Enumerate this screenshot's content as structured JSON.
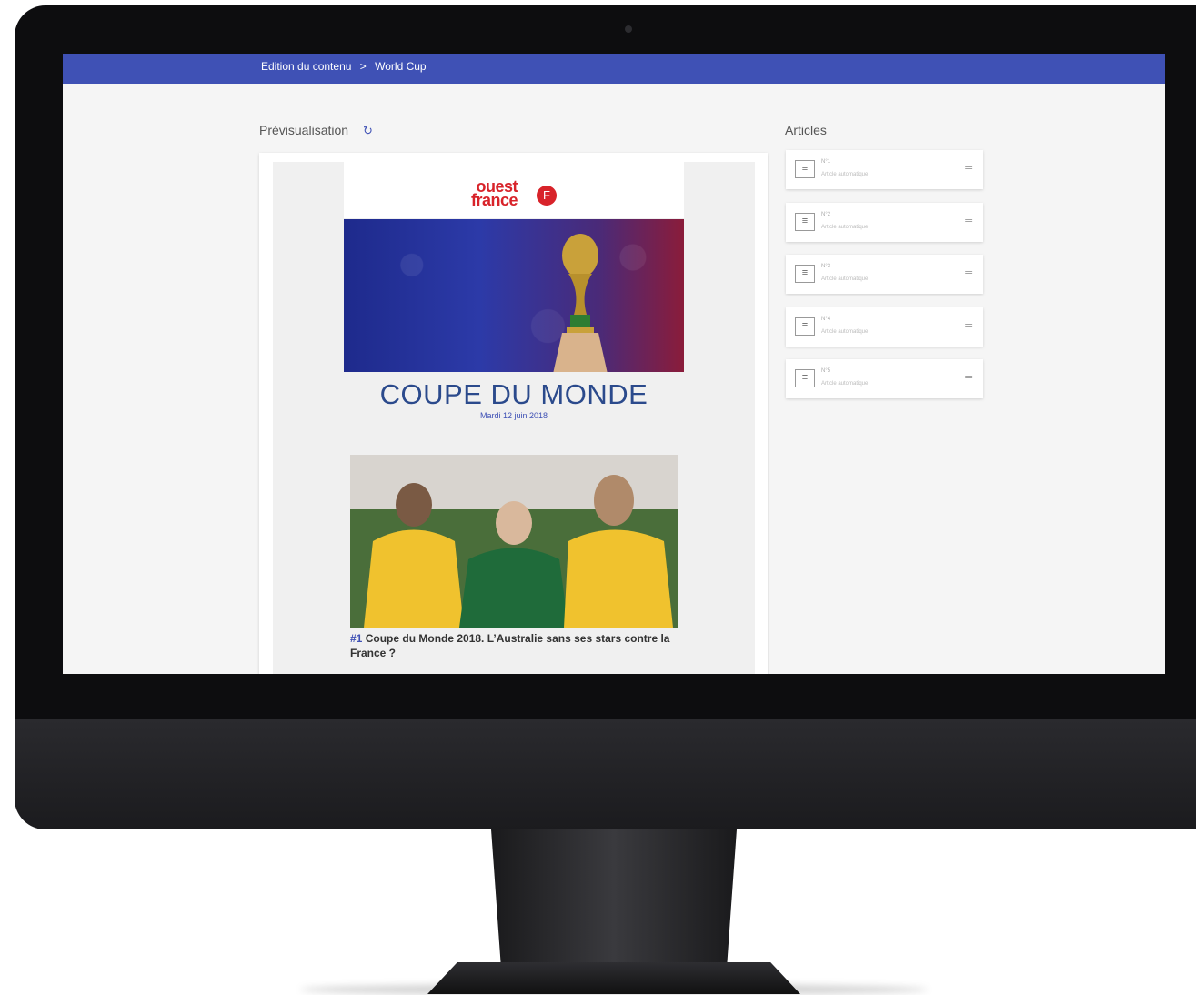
{
  "breadcrumb": {
    "part1": "Edition du contenu",
    "separator": ">",
    "part2": "World Cup"
  },
  "preview": {
    "title": "Prévisualisation",
    "refresh_icon": "refresh-icon"
  },
  "articles_panel": {
    "title": "Articles",
    "items": [
      {
        "num": "N°1",
        "sub": "Article automatique"
      },
      {
        "num": "N°2",
        "sub": "Article automatique"
      },
      {
        "num": "N°3",
        "sub": "Article automatique"
      },
      {
        "num": "N°4",
        "sub": "Article automatique"
      },
      {
        "num": "N°5",
        "sub": "Article automatique"
      }
    ]
  },
  "newsletter": {
    "logo_line1": "ouest",
    "logo_line2": "france",
    "headline": "COUPE DU MONDE",
    "date": "Mardi 12 juin 2018",
    "article": {
      "num": "#1",
      "title": "Coupe du Monde 2018. L’Australie sans ses stars contre la France ?"
    }
  },
  "colors": {
    "primary": "#3f51b5",
    "brand_red": "#d8232a"
  }
}
